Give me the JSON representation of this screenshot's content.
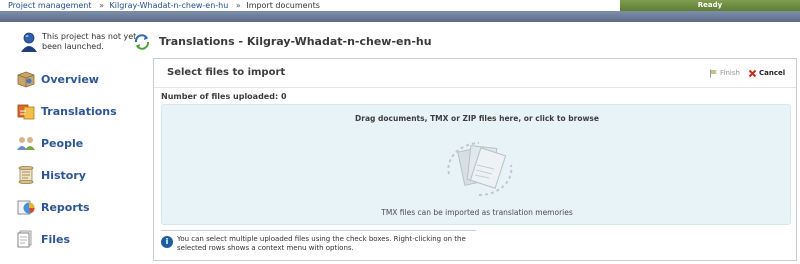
{
  "breadcrumb": {
    "items": [
      "Project management",
      "Kilgray-Whadat-n-chew-en-hu",
      "Import documents"
    ],
    "separator": "»"
  },
  "status_bar": {
    "text": "Ready"
  },
  "project_status": {
    "text": "This project has not yet been launched."
  },
  "sidebar": {
    "items": [
      {
        "label": "Overview",
        "icon": "overview-box-icon"
      },
      {
        "label": "Translations",
        "icon": "translations-icon"
      },
      {
        "label": "People",
        "icon": "people-icon"
      },
      {
        "label": "History",
        "icon": "history-scroll-icon"
      },
      {
        "label": "Reports",
        "icon": "reports-icon"
      },
      {
        "label": "Files",
        "icon": "files-icon"
      }
    ]
  },
  "page": {
    "title": "Translations - Kilgray-Whadat-n-chew-en-hu"
  },
  "panel": {
    "title": "Select files to import",
    "finish_label": "Finish",
    "cancel_label": "Cancel",
    "files_uploaded": "Number of files uploaded: 0",
    "drop_title": "Drag documents, TMX or ZIP files here, or click to browse",
    "drop_hint": "TMX files can be imported as translation memories",
    "info_text": "You can select multiple uploaded files using the check boxes. Right-clicking on the selected rows shows a context menu with options."
  },
  "colors": {
    "accent": "#2d5595",
    "header_stripe": "#6b7c99",
    "ready_bar": "#6f8d42",
    "drop_zone": "#e8f3f7",
    "cancel_red": "#cc2a1c"
  }
}
